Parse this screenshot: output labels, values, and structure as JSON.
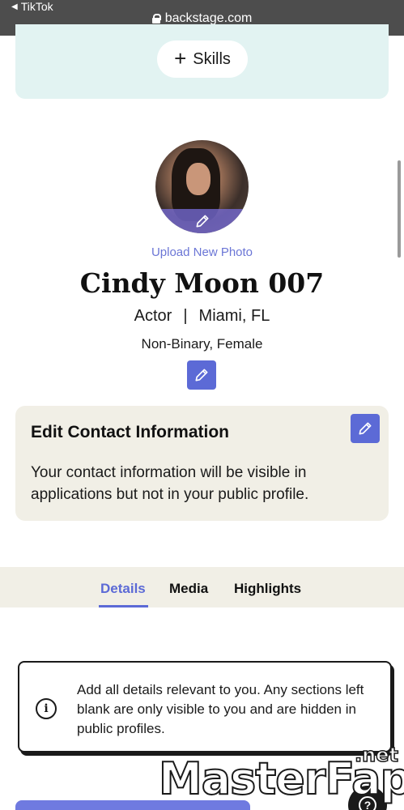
{
  "browser": {
    "back_app": "TikTok",
    "url": "backstage.com"
  },
  "skills": {
    "button_label": "Skills"
  },
  "profile": {
    "upload_label": "Upload New Photo",
    "name": "Cindy Moon 007",
    "role": "Actor",
    "separator": "|",
    "location": "Miami, FL",
    "gender": "Non-Binary, Female"
  },
  "contact": {
    "title": "Edit Contact Information",
    "description": "Your contact information will be visible in applications but not in your public profile."
  },
  "tabs": {
    "items": [
      {
        "label": "Details",
        "active": true
      },
      {
        "label": "Media",
        "active": false
      },
      {
        "label": "Highlights",
        "active": false
      }
    ]
  },
  "info": {
    "icon_glyph": "i",
    "text": "Add all details relevant to you. Any sections left blank are only visible to you and are hidden in public profiles."
  },
  "help": {
    "glyph": "?"
  },
  "watermark": {
    "main": "MasterFap",
    "suffix": ".net"
  },
  "colors": {
    "accent": "#5c6ad6",
    "skills_bg": "#e2f3f2",
    "card_bg": "#f1efe6",
    "topbar": "#4d4d4d"
  }
}
